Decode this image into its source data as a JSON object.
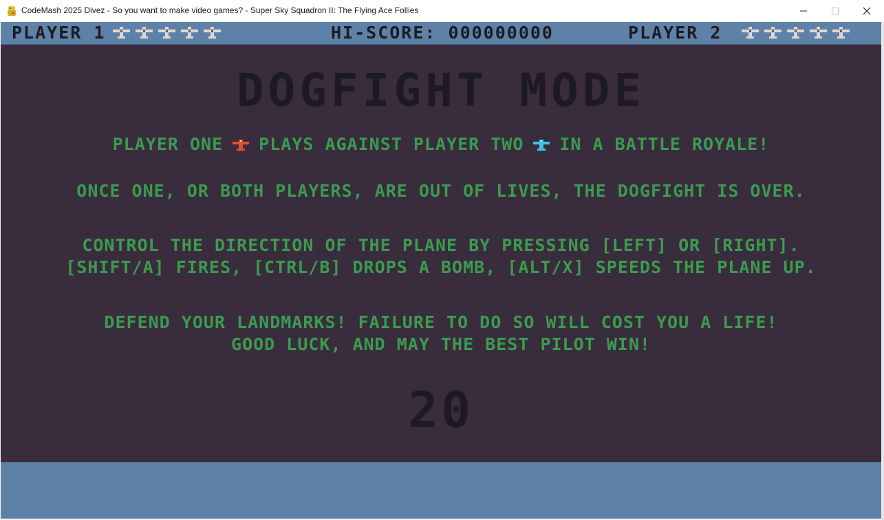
{
  "window": {
    "title": "CodeMash 2025 Divez - So you want to make video games? - Super Sky Squadron II: The Flying Ace Follies",
    "app_icon": "python-icon",
    "controls": [
      "minimize-icon",
      "maximize-icon",
      "close-icon"
    ]
  },
  "hud": {
    "player1_label": "PLAYER 1",
    "player1_lives": 5,
    "hiscore_label": "HI-SCORE: 000000000",
    "player2_label": "PLAYER 2",
    "player2_lives": 5,
    "life_icon": "plane-icon"
  },
  "screen": {
    "heading": "DOGFIGHT MODE",
    "line1_a": "PLAYER ONE",
    "line1_b": "PLAYS AGAINST PLAYER TWO",
    "line1_c": "IN A BATTLE ROYALE!",
    "line2": "ONCE ONE, OR BOTH PLAYERS, ARE OUT OF LIVES, THE DOGFIGHT IS OVER.",
    "line3": "CONTROL THE DIRECTION OF THE PLANE BY PRESSING [LEFT] OR [RIGHT].",
    "line4": "[SHIFT/A] FIRES, [CTRL/B] DROPS A BOMB, [ALT/X] SPEEDS THE PLANE UP.",
    "line5": "DEFEND YOUR LANDMARKS!  FAILURE TO DO SO WILL COST YOU A LIFE!",
    "line6": "GOOD LUCK, AND MAY THE BEST PILOT WIN!",
    "countdown": "20"
  },
  "colors": {
    "background": "#392c3d",
    "hud": "#5e82a7",
    "text_green": "#3b9b4e",
    "text_dark": "#1d1a24",
    "player1_plane": "#e0532f",
    "player2_plane": "#3fc4e8"
  }
}
